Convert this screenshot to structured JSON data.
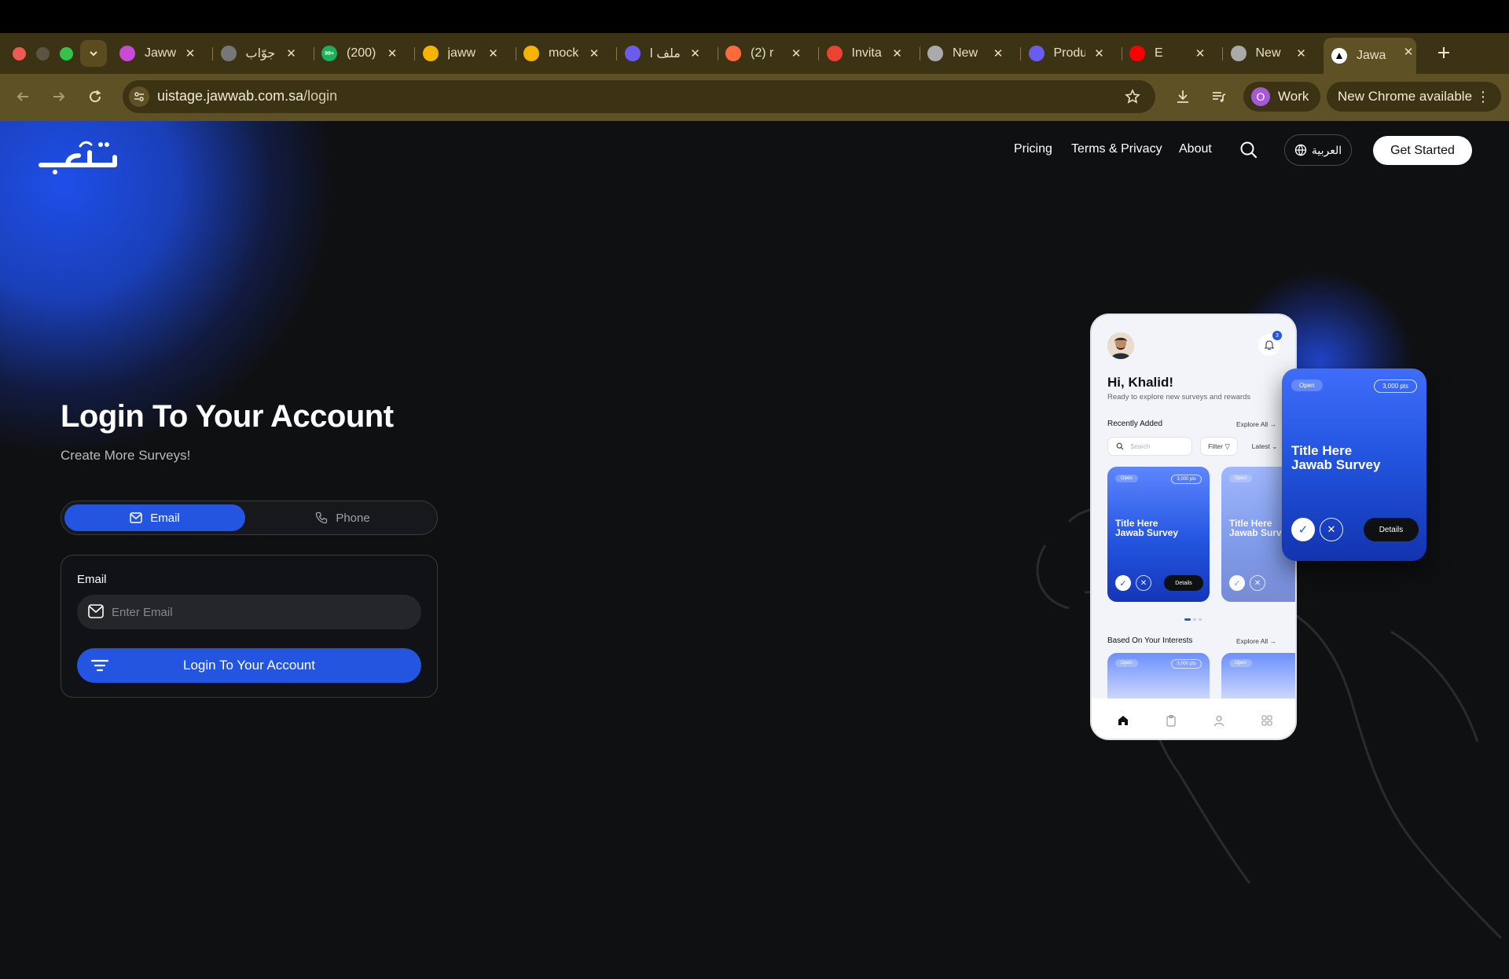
{
  "browser": {
    "tabs": [
      {
        "title": "Jaww",
        "icon": "figma-like-icon",
        "color": "#c94ad8"
      },
      {
        "title": "جوّاب",
        "icon": "globe-gray-icon",
        "color": "#777777"
      },
      {
        "title": "(200)",
        "icon": "whatsapp-icon",
        "color": "#1fae5b",
        "badge": "99+"
      },
      {
        "title": "jaww",
        "icon": "google-drive-icon",
        "color": "#f4b400"
      },
      {
        "title": "mock",
        "icon": "google-drive-icon",
        "color": "#f4b400"
      },
      {
        "title": "ملف ا",
        "icon": "shield-app-icon",
        "color": "#6b5cf0"
      },
      {
        "title": "(2) r",
        "icon": "rocket-icon",
        "color": "#ff6b3d"
      },
      {
        "title": "Invita",
        "icon": "gmail-icon",
        "color": "#ea4335"
      },
      {
        "title": "New",
        "icon": "chrome-icon",
        "color": "#aaaaaa"
      },
      {
        "title": "Produ",
        "icon": "shield-app-icon",
        "color": "#6b5cf0"
      },
      {
        "title": "E",
        "icon": "youtube-icon",
        "color": "#ff0000"
      },
      {
        "title": "New",
        "icon": "chrome-icon",
        "color": "#aaaaaa"
      },
      {
        "title": "Jawa",
        "icon": "vercel-icon",
        "color": "#ffffff",
        "active": true
      }
    ],
    "url_host": "uistage.jawwab.com.sa",
    "url_path": "/login",
    "profile_initial": "O",
    "profile_name": "Work",
    "update_label": "New Chrome available"
  },
  "nav": {
    "links": [
      "Pricing",
      "Terms & Privacy",
      "About"
    ],
    "language_label": "العربية",
    "cta_label": "Get Started"
  },
  "login": {
    "title": "Login To Your Account",
    "subtitle": "Create More Surveys!",
    "method_email": "Email",
    "method_phone": "Phone",
    "email_label": "Email",
    "email_placeholder": "Enter Email",
    "submit_label": "Login To Your Account"
  },
  "mockup": {
    "greeting": "Hi, Khalid!",
    "greeting_sub": "Ready to explore new surveys and rewards",
    "notification_count": "3",
    "recently_added": "Recently Added",
    "explore_all": "Explore All",
    "search_placeholder": "Search",
    "filter_label": "Filter",
    "latest_label": "Latest",
    "based_on_interests": "Based On Your Interests",
    "card_status": "Open",
    "card_points": "3,000 pts",
    "card_title_line1": "Title Here",
    "card_title_line2": "Jawab Survey",
    "details_label": "Details"
  },
  "colors": {
    "accent": "#2355e0",
    "background": "#0f1012",
    "chrome_tabstrip": "#3c3214",
    "chrome_toolbar": "#5e5126"
  }
}
